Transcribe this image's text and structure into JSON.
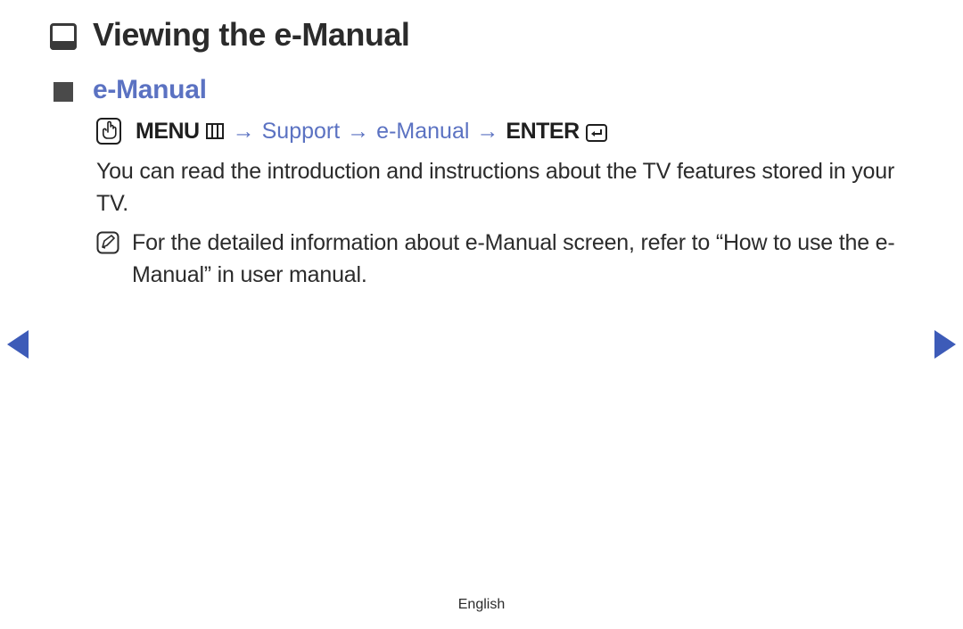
{
  "page": {
    "title": "Viewing the e-Manual",
    "section": "e-Manual"
  },
  "nav_path": {
    "menu_label": "MENU",
    "arrow": "→",
    "support": "Support",
    "emanual": "e-Manual",
    "enter_label": "ENTER"
  },
  "body": {
    "intro": "You can read the introduction and instructions about the TV features stored in your TV.",
    "note": "For the detailed information about e-Manual screen, refer to “How to use the e-Manual” in user manual."
  },
  "footer": {
    "language": "English"
  },
  "colors": {
    "accent": "#5b72c2",
    "nav_arrow": "#3d5bb8",
    "text": "#2b2b2b"
  }
}
